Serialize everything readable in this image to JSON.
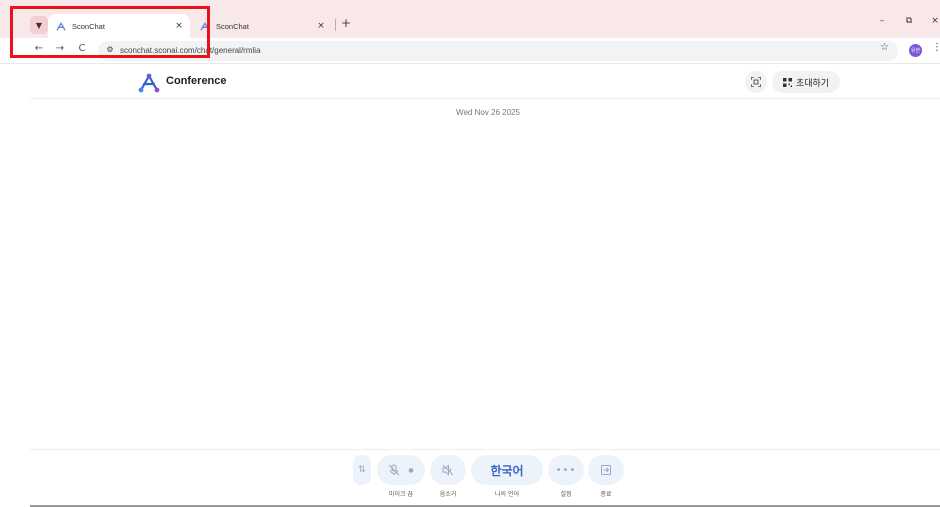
{
  "browser": {
    "tabs": [
      {
        "title": "SconChat",
        "close": "×"
      },
      {
        "title": "SconChat",
        "close": "×"
      }
    ],
    "tab_menu_icon": "chevron-down-icon",
    "new_tab_label": "+",
    "window_controls": [
      "–",
      "⧉",
      "×"
    ],
    "nav": {
      "back": "←",
      "forward": "→",
      "reload": "C"
    },
    "url": "sconchat.sconai.com/chat/general/rmlia",
    "bookmark_icon": "☆",
    "profile_initials": "유한",
    "menu_icon": "⋮"
  },
  "app": {
    "title": "Conference",
    "invite_label": "초대하기",
    "date": "Wed Nov 26 2025"
  },
  "controls": {
    "mic_label": "마이크 끔",
    "speaker_label": "음소거",
    "language_value": "한국어",
    "language_label": "나의 언어",
    "settings_value": "•••",
    "settings_label": "설정",
    "exit_label": "종료"
  },
  "colors": {
    "tabbar_bg": "#f9e8ea",
    "highlight": "#e8131b",
    "accent_blue": "#3a63c4",
    "control_bg": "#edf3fb",
    "profile_bg": "#7b56d8"
  }
}
